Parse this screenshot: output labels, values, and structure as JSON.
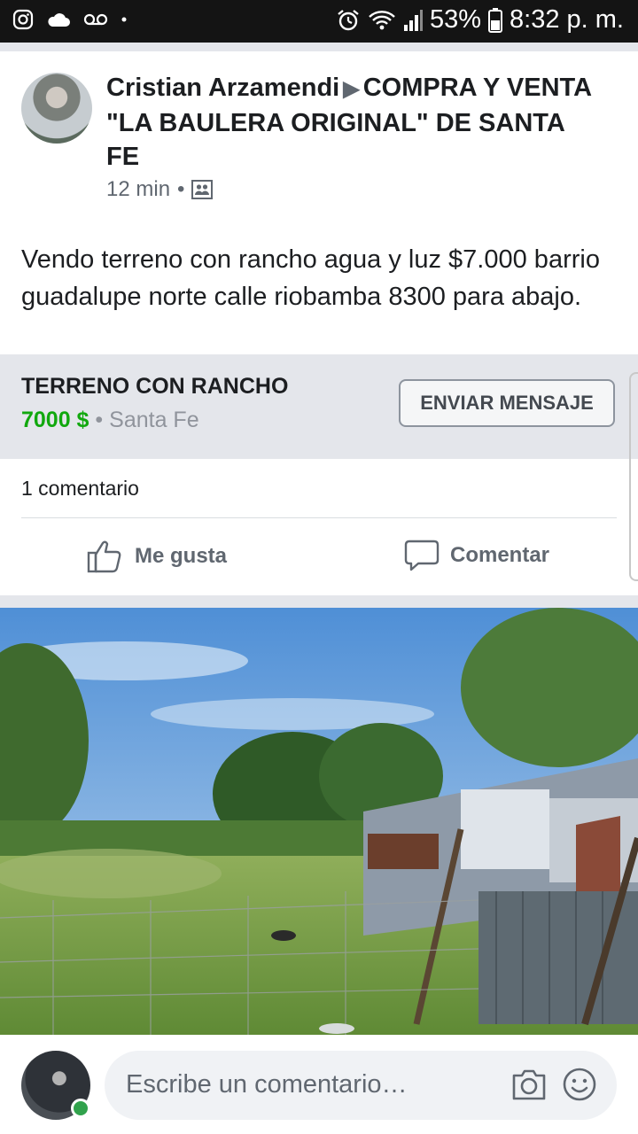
{
  "status_bar": {
    "battery": "53%",
    "time": "8:32 p. m.",
    "icons": [
      "instagram-icon",
      "cloud-icon",
      "voicemail-icon",
      "dot-icon",
      "alarm-icon",
      "wifi-icon",
      "signal-icon",
      "battery-icon"
    ]
  },
  "post": {
    "author": "Cristian Arzamendi",
    "group": "COMPRA Y VENTA \"LA BAULERA ORIGINAL\" DE SANTA FE",
    "time": "12 min",
    "text": "Vendo terreno con rancho agua y luz $7.000 barrio guadalupe norte calle riobamba 8300 para abajo."
  },
  "listing": {
    "title": "TERRENO CON RANCHO",
    "price": "7000 $",
    "separator": "•",
    "location": "Santa Fe",
    "button_label": "ENVIAR MENSAJE"
  },
  "engagement": {
    "comments_count": "1 comentario",
    "like_label": "Me gusta",
    "comment_label": "Comentar"
  },
  "comment_composer": {
    "placeholder": "Escribe un comentario…"
  },
  "colors": {
    "price_green": "#11a80e",
    "listing_bg": "#e4e6eb",
    "online_green": "#31a24c"
  }
}
